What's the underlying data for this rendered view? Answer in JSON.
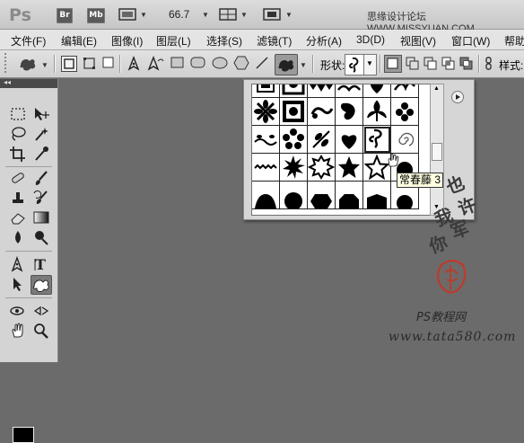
{
  "titlebar": {
    "app_logo": "Ps",
    "buttons": [
      {
        "name": "bridge",
        "label": "Br"
      },
      {
        "name": "mini-bridge",
        "label": "Mb"
      }
    ],
    "zoom": "66.7",
    "site_watermark": "思缘设计论坛 WWW.MISSYUAN.COM"
  },
  "menu": {
    "items": [
      "文件(F)",
      "编辑(E)",
      "图像(I)",
      "图层(L)",
      "选择(S)",
      "滤镜(T)",
      "分析(A)",
      "3D(D)",
      "视图(V)",
      "窗口(W)",
      "帮助"
    ]
  },
  "options": {
    "shape_label": "形状:",
    "style_label": "样式:"
  },
  "picker": {
    "tooltip": "常春藤 3"
  },
  "watermark": {
    "vertical_chars": [
      "也",
      "许",
      "我",
      "军",
      "你"
    ],
    "brand": "PS教程网",
    "url": "www.tata580.com"
  },
  "colors": {
    "canvas_bg": "#6b6b6b",
    "panel_bg": "#d4d4d4",
    "seal_red": "#c0392b"
  }
}
